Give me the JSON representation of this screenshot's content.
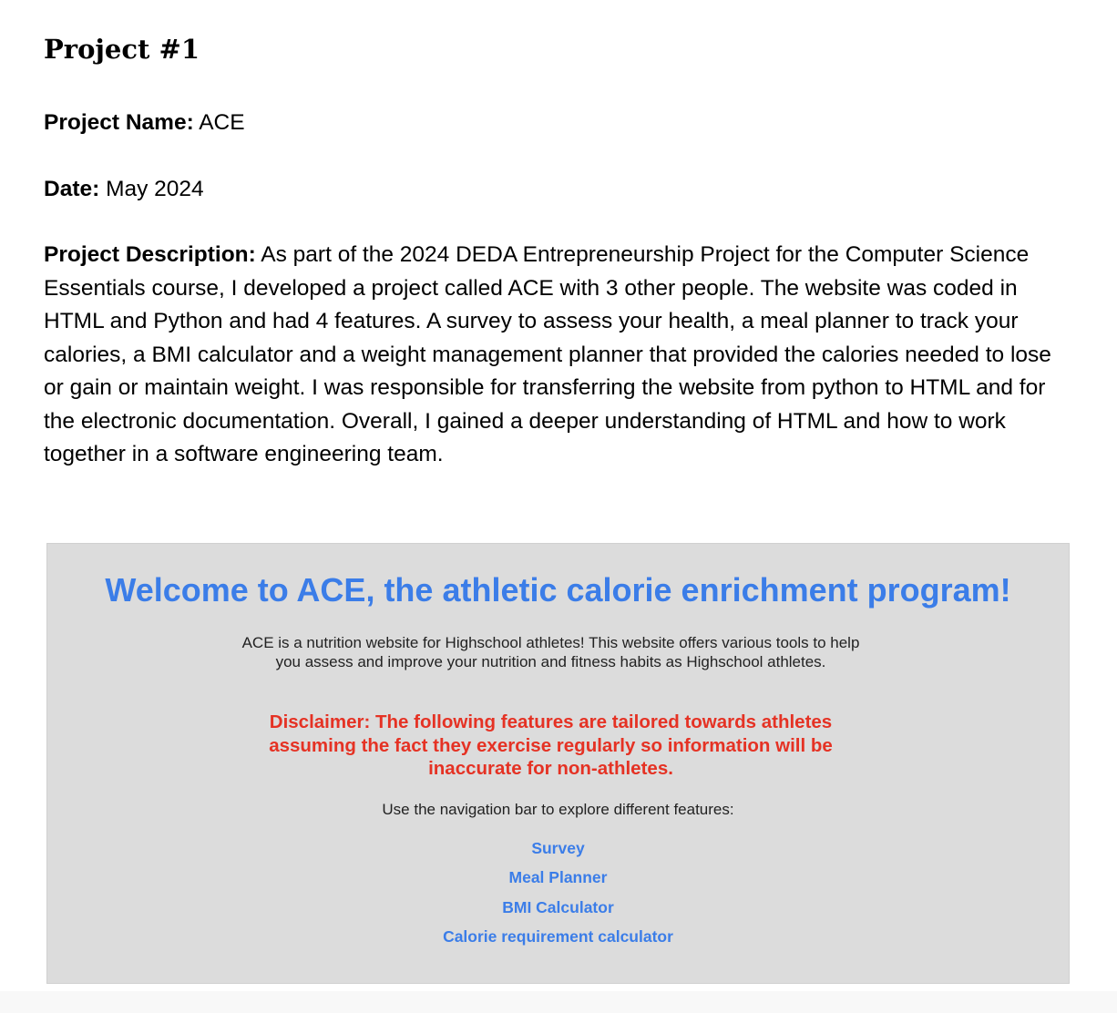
{
  "document": {
    "title": "Project #1",
    "project_name_label": "Project Name:",
    "project_name_value": " ACE",
    "date_label": "Date:",
    "date_value": " May 2024",
    "description_label": "Project Description:",
    "description_value": " As part of the 2024 DEDA Entrepreneurship Project for the Computer Science Essentials course, I developed a project called ACE with 3 other people. The website was coded in HTML and Python and had 4 features. A survey to assess your health, a meal planner to track your calories, a BMI calculator and a weight management planner that provided the calories needed to lose or gain or maintain weight. I was responsible for transferring the website from python to HTML and for the electronic documentation. Overall, I gained a deeper understanding of HTML and how to work together in a software engineering team."
  },
  "screenshot": {
    "welcome_heading": "Welcome to ACE, the athletic calorie enrichment program!",
    "intro_text": "ACE is a nutrition website for Highschool athletes! This website offers various tools to help you assess and improve your nutrition and fitness habits as Highschool athletes.",
    "disclaimer_text": "Disclaimer: The following features are tailored towards athletes assuming the fact they exercise regularly so information will be inaccurate for non-athletes.",
    "nav_hint": "Use the navigation bar to explore different features:",
    "nav_links": [
      {
        "label": "Survey"
      },
      {
        "label": "Meal Planner"
      },
      {
        "label": "BMI Calculator"
      },
      {
        "label": "Calorie requirement calculator"
      }
    ]
  },
  "colors": {
    "link_blue": "#3b7de8",
    "disclaimer_red": "#e53224",
    "panel_gray": "#dcdcdc"
  }
}
